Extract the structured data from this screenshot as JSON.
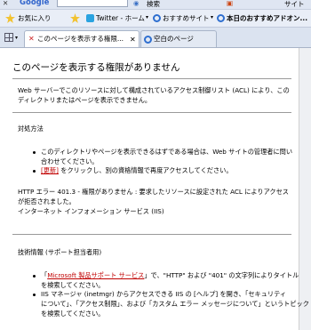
{
  "toolbar_top": {
    "google_label": "Google",
    "search_button": "検索",
    "site_label": "サイト"
  },
  "favorites_bar": {
    "favorites_label": "お気に入り",
    "items": [
      {
        "label": "Twitter - ホーム"
      },
      {
        "label": "おすすめサイト"
      },
      {
        "label": "本日のおすすめアドオン..."
      }
    ]
  },
  "tabs": [
    {
      "label": "このページを表示する権限...",
      "active": true
    },
    {
      "label": "空白のページ",
      "active": false
    }
  ],
  "page": {
    "title": "このページを表示する権限がありません",
    "intro_line1": "Web サーバーでこのリソースに対して構成されているアクセス制御リスト (ACL) により、この",
    "intro_line2": "ディレクトリまたはページを表示できません。",
    "steps_heading": "対処方法",
    "step1_line1": "このディレクトリやページを表示できるはずである場合は、Web サイトの管理者に問い",
    "step1_line2": "合わせてください。",
    "step2_link": "[更新]",
    "step2_rest": " をクリックし、別の資格情報で再度アクセスしてください。",
    "error_line1": "HTTP エラー 401.3 - 権限がありません : 要求したリソースに設定された ACL によりアクセス",
    "error_line2": "が拒否されました。",
    "error_line3": "インターネット インフォメーション サービス (IIS)",
    "tech_heading": "技術情報 (サポート担当者用)",
    "tech1_prefix": "「",
    "tech1_link": "Microsoft 製品サポート サービス",
    "tech1_rest": "」で、\"HTTP\" および \"401\" の文字列によりタイトル",
    "tech1_line2": "を検索してください。",
    "tech2_line1": "IIS マネージャ (inetmgr) からアクセスできる IIS の [ヘルプ] を開き、「セキュリティ",
    "tech2_line2": "について」、「アクセス制限」、および「カスタム エラー メッセージについて」というトピック",
    "tech2_line3": "を検索してください。"
  }
}
